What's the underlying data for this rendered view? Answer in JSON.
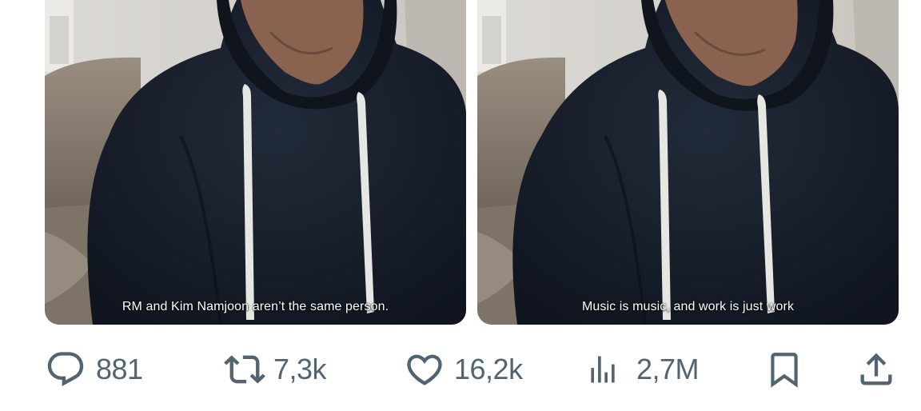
{
  "media": [
    {
      "caption": "RM and Kim Namjoon aren’t the same person."
    },
    {
      "caption": "Music is music, and work is just work"
    }
  ],
  "actions": {
    "reply": {
      "icon": "reply-icon",
      "count": "881"
    },
    "repost": {
      "icon": "repost-icon",
      "count": "7,3k"
    },
    "like": {
      "icon": "heart-icon",
      "count": "16,2k"
    },
    "views": {
      "icon": "analytics-icon",
      "count": "2,7M"
    },
    "bookmark": {
      "icon": "bookmark-icon"
    },
    "share": {
      "icon": "share-icon"
    }
  },
  "colors": {
    "icon_gray": "#536471",
    "hoodie": "#1a2230",
    "background": "#ffffff"
  }
}
